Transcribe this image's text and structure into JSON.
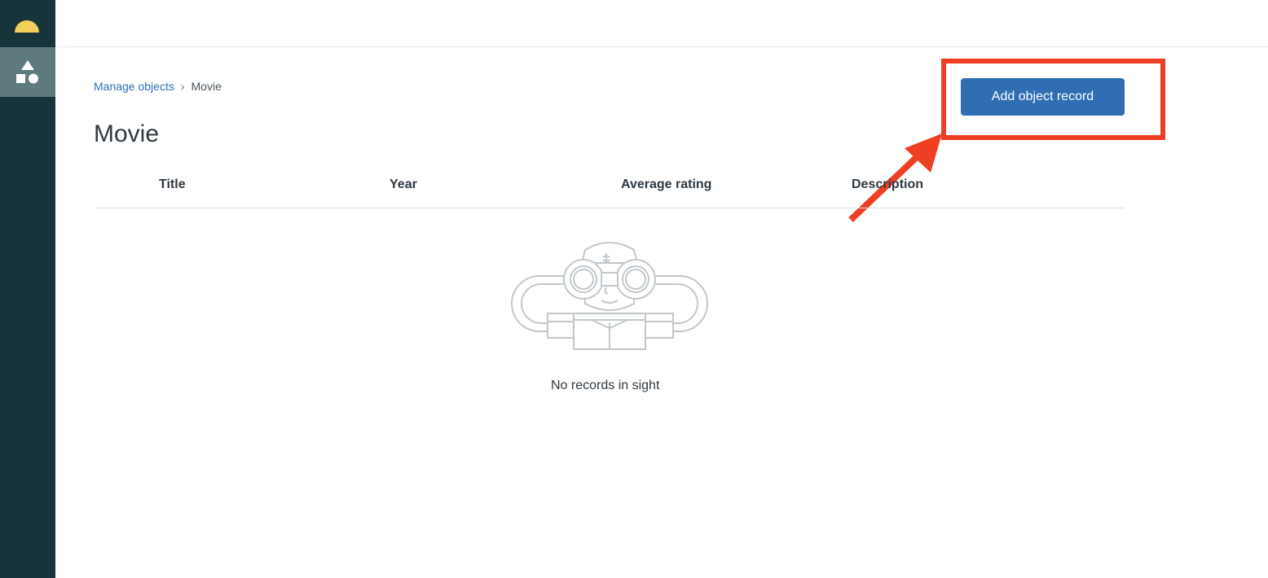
{
  "sidebar": {
    "brand_icon": "sun-logo-icon",
    "nav_items": [
      {
        "icon": "objects-shapes-icon",
        "active": true
      }
    ]
  },
  "breadcrumb": {
    "parent": "Manage objects",
    "separator": "›",
    "current": "Movie"
  },
  "page": {
    "title": "Movie",
    "primary_action": "Add object record"
  },
  "table": {
    "columns": [
      "Title",
      "Year",
      "Average rating",
      "Description"
    ]
  },
  "empty_state": {
    "illustration": "sailor-binoculars-illustration",
    "message": "No records in sight"
  },
  "annotation": {
    "color": "#ee3f23"
  },
  "colors": {
    "sidebar": "#17343b",
    "sidebar_active": "#5f7a7e",
    "brand": "#f1cf5b",
    "button": "#2f6eb3",
    "link": "#2c6fb7"
  }
}
